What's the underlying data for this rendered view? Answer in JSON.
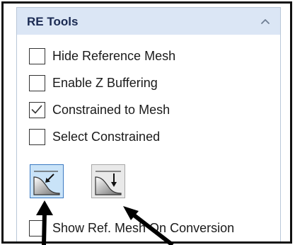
{
  "panel": {
    "title": "RE Tools",
    "collapse_icon": "chevron-up-icon"
  },
  "options": [
    {
      "label": "Hide Reference Mesh",
      "checked": false
    },
    {
      "label": "Enable Z Buffering",
      "checked": false
    },
    {
      "label": "Constrained to Mesh",
      "checked": true
    },
    {
      "label": "Select Constrained",
      "checked": false
    }
  ],
  "tools": [
    {
      "icon": "project-to-mesh-icon",
      "active": true
    },
    {
      "icon": "project-down-icon",
      "active": false
    }
  ],
  "conversion_option": {
    "label": "Show Ref. Mesh On Conversion",
    "checked": false
  },
  "annotations": {
    "arrows": 2,
    "arrow_color": "#000000"
  },
  "colors": {
    "header_bg": "#dbe6f5",
    "title_text": "#1a2a52",
    "active_button_bg": "#c9e3f8",
    "active_button_border": "#3b79c2"
  }
}
